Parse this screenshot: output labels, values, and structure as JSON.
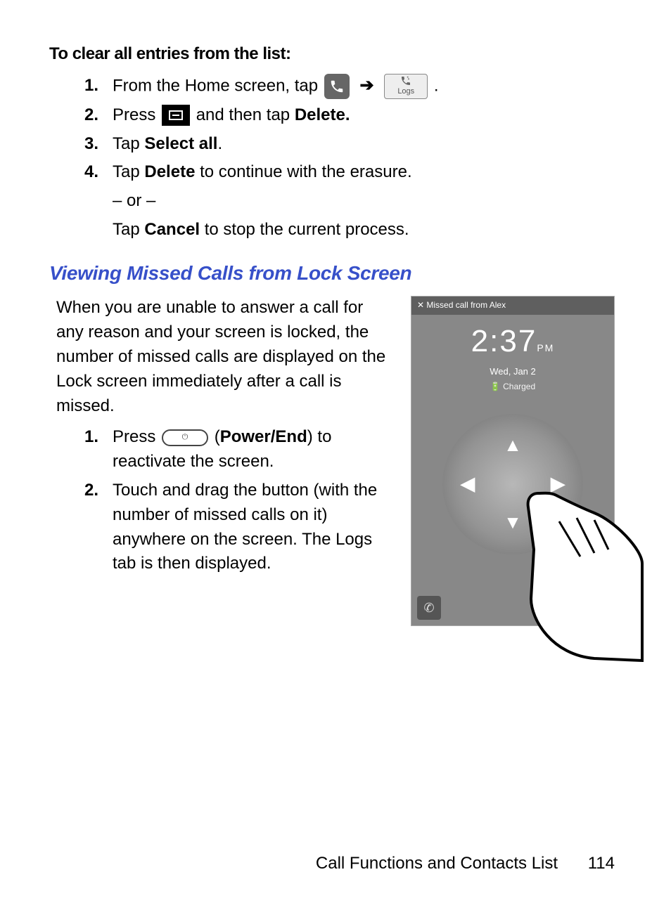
{
  "section1": {
    "title": "To clear all entries from the list:",
    "step1_pre": "From the Home screen, tap",
    "arrow": "➔",
    "logs_label": "Logs",
    "period": ".",
    "step2_pre": "Press",
    "step2_mid": "and then tap",
    "step2_bold": "Delete.",
    "step3_pre": "Tap",
    "step3_bold": "Select all",
    "step3_post": ".",
    "step4_pre": "Tap",
    "step4_bold": "Delete",
    "step4_post": "to continue with the erasure.",
    "or": "– or –",
    "step4b_pre": "Tap",
    "step4b_bold": "Cancel",
    "step4b_post": "to stop the current process."
  },
  "section2": {
    "heading": "Viewing Missed Calls from Lock Screen",
    "intro": "When you are unable to answer a call for any reason and your screen is locked, the number of missed calls are displayed on the Lock screen immediately after a call is missed.",
    "step1_pre": "Press",
    "step1_paren_open": "(",
    "step1_bold": "Power/End",
    "step1_paren_close": ") to reactivate the screen.",
    "step2": "Touch and drag the button (with the number of missed calls on it) anywhere on the screen. The Logs tab is then displayed."
  },
  "lockscreen": {
    "notif": "✕  Missed call from Alex",
    "time": "2:37",
    "ampm": "PM",
    "date": "Wed, Jan 2",
    "charged": "🔋 Charged"
  },
  "footer": {
    "chapter": "Call Functions and Contacts List",
    "page": "114"
  },
  "nums": {
    "n1": "1.",
    "n2": "2.",
    "n3": "3.",
    "n4": "4."
  }
}
